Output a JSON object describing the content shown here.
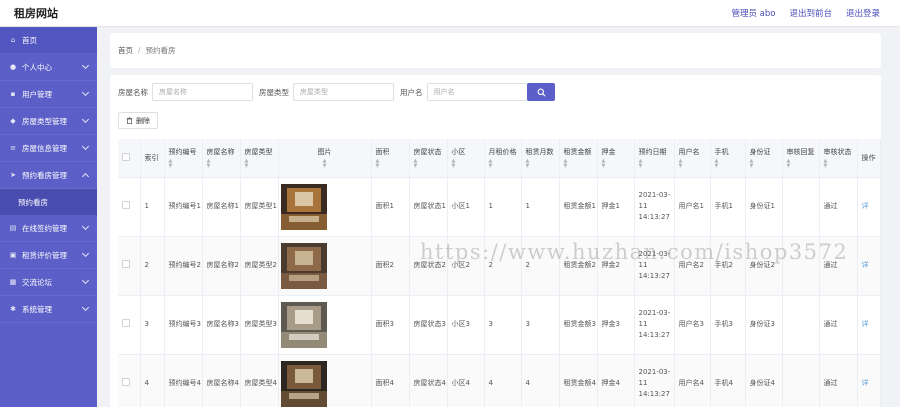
{
  "header": {
    "title": "租房网站",
    "user": "管理员 abo",
    "front": "退出到前台",
    "logout": "退出登录"
  },
  "sidebar": {
    "items": [
      {
        "label": "首页",
        "icon": "home-icon"
      },
      {
        "label": "个人中心",
        "icon": "user-icon"
      },
      {
        "label": "用户管理",
        "icon": "users-icon"
      },
      {
        "label": "房屋类型管理",
        "icon": "tag-icon"
      },
      {
        "label": "房屋信息管理",
        "icon": "list-icon"
      },
      {
        "label": "预约看房管理",
        "icon": "send-icon"
      },
      {
        "label": "在线签约管理",
        "icon": "doc-icon"
      },
      {
        "label": "租赁评价管理",
        "icon": "chat-icon"
      },
      {
        "label": "交流论坛",
        "icon": "forum-icon"
      },
      {
        "label": "系统管理",
        "icon": "gear-icon"
      }
    ],
    "sub": "预约看房"
  },
  "breadcrumb": {
    "home": "首页",
    "sep": "/",
    "current": "预约看房"
  },
  "search": {
    "name_label": "房屋名称",
    "name_placeholder": "房屋名称",
    "type_label": "房屋类型",
    "type_placeholder": "房屋类型",
    "user_label": "用户名",
    "user_placeholder": "用户名"
  },
  "toolbar": {
    "delete": "删除"
  },
  "table": {
    "headers": [
      "索引",
      "预约编号",
      "房屋名称",
      "房屋类型",
      "图片",
      "面积",
      "房屋状态",
      "小区",
      "月租价格",
      "租赁月数",
      "租赁金额",
      "押金",
      "预约日期",
      "用户名",
      "手机",
      "身份证",
      "审核回复",
      "审核状态",
      "操作"
    ],
    "rows": [
      [
        "1",
        "预约编号1",
        "房屋名称1",
        "房屋类型1",
        "面积1",
        "房屋状态1",
        "小区1",
        "1",
        "1",
        "租赁金额1",
        "押金1",
        "2021-03-11 14:13:27",
        "用户名1",
        "手机1",
        "身份证1",
        "",
        "通过",
        "详"
      ],
      [
        "2",
        "预约编号2",
        "房屋名称2",
        "房屋类型2",
        "面积2",
        "房屋状态2",
        "小区2",
        "2",
        "2",
        "租赁金额2",
        "押金2",
        "2021-03-11 14:13:27",
        "用户名2",
        "手机2",
        "身份证2",
        "",
        "通过",
        "详"
      ],
      [
        "3",
        "预约编号3",
        "房屋名称3",
        "房屋类型3",
        "面积3",
        "房屋状态3",
        "小区3",
        "3",
        "3",
        "租赁金额3",
        "押金3",
        "2021-03-11 14:13:27",
        "用户名3",
        "手机3",
        "身份证3",
        "",
        "通过",
        "详"
      ],
      [
        "4",
        "预约编号4",
        "房屋名称4",
        "房屋类型4",
        "面积4",
        "房屋状态4",
        "小区4",
        "4",
        "4",
        "租赁金额4",
        "押金4",
        "2021-03-11 14:13:27",
        "用户名4",
        "手机4",
        "身份证4",
        "",
        "通过",
        "详"
      ]
    ]
  },
  "watermark": "https://www.huzhan.com/ishop3572",
  "colors": {
    "accent": "#5b5fc7",
    "sidebar": "#5b5fc7",
    "link": "#4a4fb8"
  }
}
